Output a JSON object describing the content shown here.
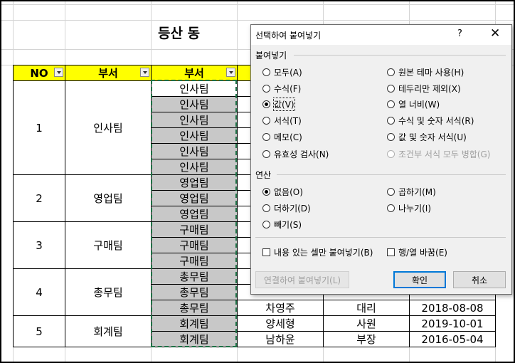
{
  "sheet": {
    "title": "등산 동",
    "headers": [
      "NO",
      "부서",
      "부서",
      "",
      "",
      ""
    ],
    "groups": [
      {
        "no": "1",
        "dept": "인사팀"
      },
      {
        "no": "2",
        "dept": "영업팀"
      },
      {
        "no": "3",
        "dept": "구매팀"
      },
      {
        "no": "4",
        "dept": "총무팀"
      },
      {
        "no": "5",
        "dept": "회계팀"
      }
    ],
    "rows": [
      {
        "dept2": "인사팀",
        "name": "",
        "rank": "",
        "date": ""
      },
      {
        "dept2": "인사팀",
        "name": "",
        "rank": "",
        "date": ""
      },
      {
        "dept2": "인사팀",
        "name": "",
        "rank": "",
        "date": ""
      },
      {
        "dept2": "인사팀",
        "name": "",
        "rank": "",
        "date": ""
      },
      {
        "dept2": "인사팀",
        "name": "",
        "rank": "",
        "date": ""
      },
      {
        "dept2": "인사팀",
        "name": "",
        "rank": "",
        "date": ""
      },
      {
        "dept2": "영업팀",
        "name": "",
        "rank": "",
        "date": ""
      },
      {
        "dept2": "영업팀",
        "name": "",
        "rank": "",
        "date": ""
      },
      {
        "dept2": "영업팀",
        "name": "",
        "rank": "",
        "date": ""
      },
      {
        "dept2": "구매팀",
        "name": "",
        "rank": "",
        "date": ""
      },
      {
        "dept2": "구매팀",
        "name": "",
        "rank": "",
        "date": ""
      },
      {
        "dept2": "구매팀",
        "name": "",
        "rank": "",
        "date": ""
      },
      {
        "dept2": "총무팀",
        "name": "",
        "rank": "",
        "date": ""
      },
      {
        "dept2": "총무팀",
        "name": "",
        "rank": "",
        "date": ""
      },
      {
        "dept2": "총무팀",
        "name": "차영주",
        "rank": "대리",
        "date": "2018-08-08"
      },
      {
        "dept2": "회계팀",
        "name": "양세형",
        "rank": "사원",
        "date": "2019-10-01"
      },
      {
        "dept2": "회계팀",
        "name": "남하윤",
        "rank": "부장",
        "date": "2016-05-04"
      }
    ]
  },
  "dialog": {
    "title": "선택하여 붙여넣기",
    "help": "?",
    "close": "✕",
    "paste_group": "붙여넣기",
    "paste_left": [
      "모두(A)",
      "수식(F)",
      "값(V)",
      "서식(T)",
      "메모(C)",
      "유효성 검사(N)"
    ],
    "paste_right": [
      "원본 테마 사용(H)",
      "테두리만 제외(X)",
      "열 너비(W)",
      "수식 및 숫자 서식(R)",
      "값 및 숫자 서식(U)",
      "조건부 서식 모두 병합(G)"
    ],
    "operation_group": "연산",
    "operation_left": [
      "없음(O)",
      "더하기(D)",
      "빼기(S)"
    ],
    "operation_right": [
      "곱하기(M)",
      "나누기(I)"
    ],
    "skip_blanks": "내용 있는 셀만 붙여넣기(B)",
    "transpose": "행/열 바꿈(E)",
    "paste_link": "연결하여 붙여넣기(L)",
    "ok": "확인",
    "cancel": "취소"
  }
}
